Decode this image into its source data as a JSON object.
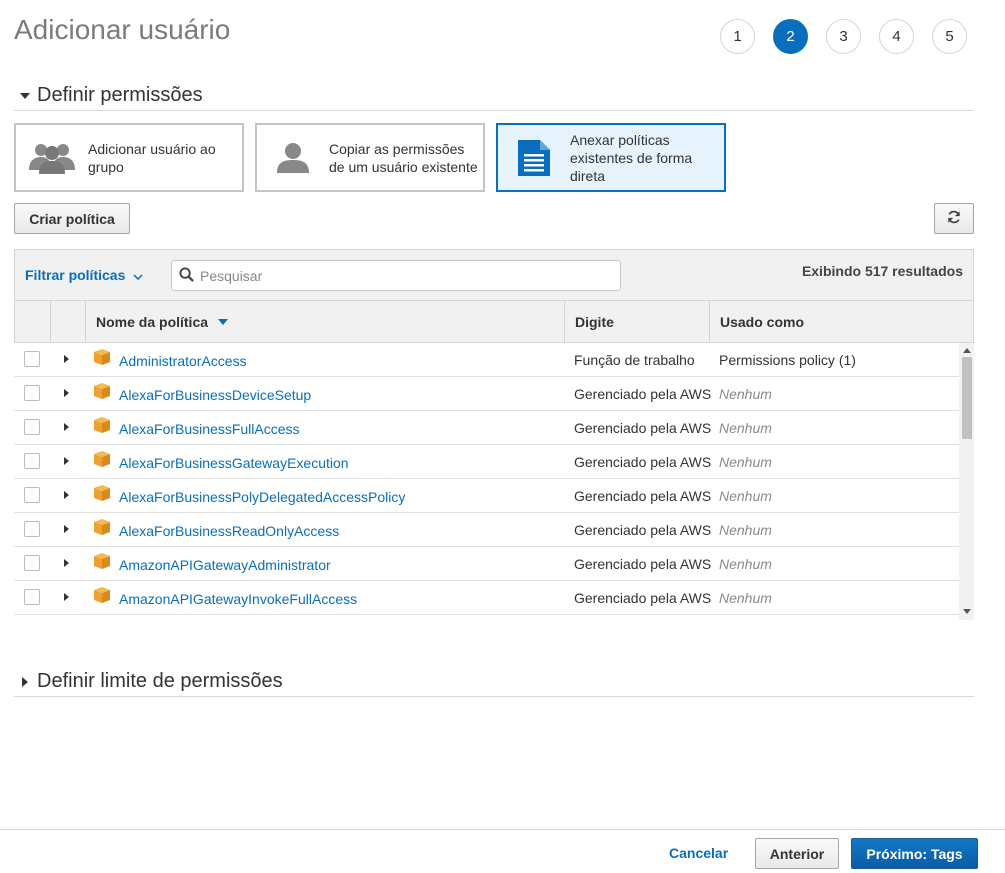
{
  "header": {
    "title": "Adicionar usuário",
    "steps": [
      "1",
      "2",
      "3",
      "4",
      "5"
    ],
    "active_step": "2"
  },
  "permissions_section": {
    "title": "Definir permissões",
    "options": [
      {
        "label": "Adicionar usuário ao grupo",
        "icon": "group-icon",
        "selected": false
      },
      {
        "label": "Copiar as permissões de um usuário existente",
        "icon": "user-icon",
        "selected": false
      },
      {
        "label": "Anexar políticas existentes de forma direta",
        "icon": "document-icon",
        "selected": true
      }
    ],
    "create_policy_label": "Criar política",
    "refresh_icon": "refresh-icon"
  },
  "policy_table": {
    "filter_label": "Filtrar políticas",
    "search_placeholder": "Pesquisar",
    "results_text": "Exibindo 517 resultados",
    "columns": {
      "name": "Nome da política",
      "type": "Digite",
      "used_as": "Usado como"
    },
    "rows": [
      {
        "name": "AdministratorAccess",
        "type": "Função de trabalho",
        "used_as": "Permissions policy (1)"
      },
      {
        "name": "AlexaForBusinessDeviceSetup",
        "type": "Gerenciado pela AWS",
        "used_as": "Nenhum"
      },
      {
        "name": "AlexaForBusinessFullAccess",
        "type": "Gerenciado pela AWS",
        "used_as": "Nenhum"
      },
      {
        "name": "AlexaForBusinessGatewayExecution",
        "type": "Gerenciado pela AWS",
        "used_as": "Nenhum"
      },
      {
        "name": "AlexaForBusinessPolyDelegatedAccessPolicy",
        "type": "Gerenciado pela AWS",
        "used_as": "Nenhum"
      },
      {
        "name": "AlexaForBusinessReadOnlyAccess",
        "type": "Gerenciado pela AWS",
        "used_as": "Nenhum"
      },
      {
        "name": "AmazonAPIGatewayAdministrator",
        "type": "Gerenciado pela AWS",
        "used_as": "Nenhum"
      },
      {
        "name": "AmazonAPIGatewayInvokeFullAccess",
        "type": "Gerenciado pela AWS",
        "used_as": "Nenhum"
      }
    ]
  },
  "boundary_section": {
    "title": "Definir limite de permissões"
  },
  "footer": {
    "cancel_label": "Cancelar",
    "previous_label": "Anterior",
    "next_label": "Próximo: Tags"
  },
  "colors": {
    "accent": "#0a6ebd",
    "policy_icon": "#f0a030",
    "selected_bg": "#e6f3fd"
  }
}
